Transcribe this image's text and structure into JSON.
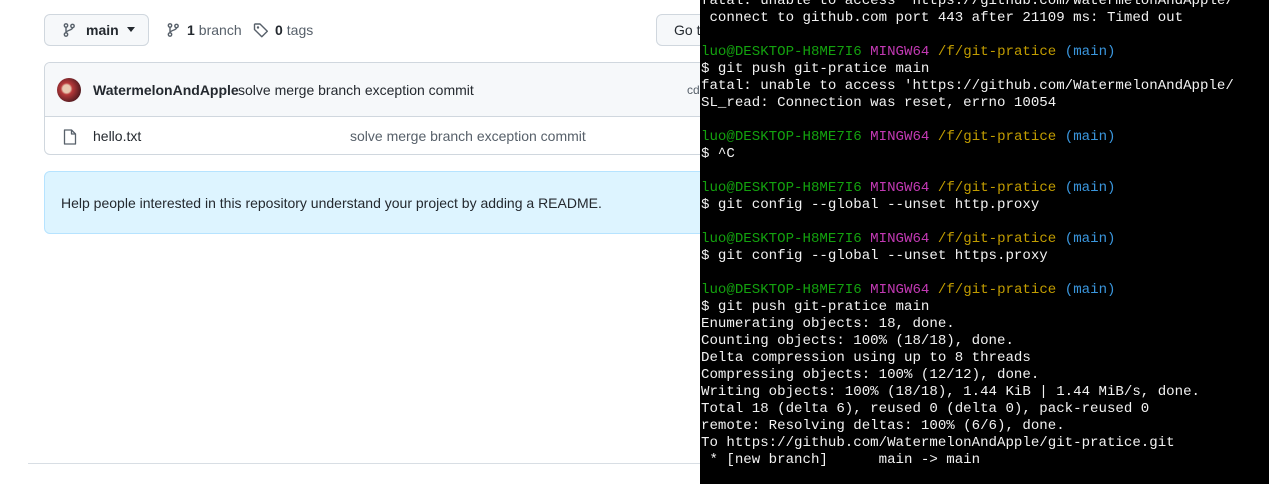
{
  "repo": {
    "branch_button_label": "main",
    "branch_count": "1",
    "branch_word": "branch",
    "tag_count": "0",
    "tag_word": "tags",
    "goto_label": "Go to file",
    "latest_commit": {
      "author": "WatermelonAndApple",
      "message": "solve merge branch exception commit",
      "hash": "cd"
    },
    "files": [
      {
        "name": "hello.txt",
        "commit_message": "solve merge branch exception commit"
      }
    ],
    "readme_prompt": "Help people interested in this repository understand your project by adding a README."
  },
  "terminal": {
    "colors": {
      "user": "#13a10e",
      "shell": "#c239b3",
      "path": "#c19c00",
      "branch": "#3a96dd",
      "text": "#f2f2f2"
    },
    "lines": [
      {
        "type": "out",
        "text": "fatal: unable to access 'https://github.com/WatermelonAndApple/"
      },
      {
        "type": "out",
        "text": " connect to github.com port 443 after 21109 ms: Timed out"
      },
      {
        "type": "blank"
      },
      {
        "type": "prompt",
        "user": "luo@DESKTOP-H8ME7I6",
        "shell": "MINGW64",
        "path": "/f/git-pratice",
        "branch": "(main)"
      },
      {
        "type": "out",
        "text": "$ git push git-pratice main"
      },
      {
        "type": "out",
        "text": "fatal: unable to access 'https://github.com/WatermelonAndApple/"
      },
      {
        "type": "out",
        "text": "SL_read: Connection was reset, errno 10054"
      },
      {
        "type": "blank"
      },
      {
        "type": "prompt",
        "user": "luo@DESKTOP-H8ME7I6",
        "shell": "MINGW64",
        "path": "/f/git-pratice",
        "branch": "(main)"
      },
      {
        "type": "out",
        "text": "$ ^C"
      },
      {
        "type": "blank"
      },
      {
        "type": "prompt",
        "user": "luo@DESKTOP-H8ME7I6",
        "shell": "MINGW64",
        "path": "/f/git-pratice",
        "branch": "(main)"
      },
      {
        "type": "out",
        "text": "$ git config --global --unset http.proxy"
      },
      {
        "type": "blank"
      },
      {
        "type": "prompt",
        "user": "luo@DESKTOP-H8ME7I6",
        "shell": "MINGW64",
        "path": "/f/git-pratice",
        "branch": "(main)"
      },
      {
        "type": "out",
        "text": "$ git config --global --unset https.proxy"
      },
      {
        "type": "blank"
      },
      {
        "type": "prompt",
        "user": "luo@DESKTOP-H8ME7I6",
        "shell": "MINGW64",
        "path": "/f/git-pratice",
        "branch": "(main)"
      },
      {
        "type": "out",
        "text": "$ git push git-pratice main"
      },
      {
        "type": "out",
        "text": "Enumerating objects: 18, done."
      },
      {
        "type": "out",
        "text": "Counting objects: 100% (18/18), done."
      },
      {
        "type": "out",
        "text": "Delta compression using up to 8 threads"
      },
      {
        "type": "out",
        "text": "Compressing objects: 100% (12/12), done."
      },
      {
        "type": "out",
        "text": "Writing objects: 100% (18/18), 1.44 KiB | 1.44 MiB/s, done."
      },
      {
        "type": "out",
        "text": "Total 18 (delta 6), reused 0 (delta 0), pack-reused 0"
      },
      {
        "type": "out",
        "text": "remote: Resolving deltas: 100% (6/6), done."
      },
      {
        "type": "out",
        "text": "To https://github.com/WatermelonAndApple/git-pratice.git"
      },
      {
        "type": "out",
        "text": " * [new branch]      main -> main"
      }
    ]
  }
}
